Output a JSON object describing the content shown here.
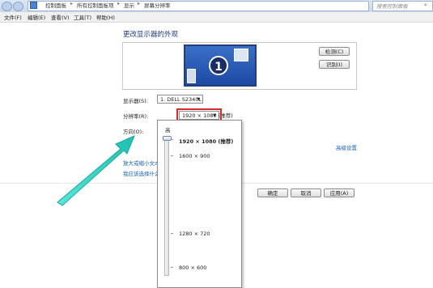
{
  "address_bar": {
    "crumbs": [
      "控制面板",
      "所有控制面板项",
      "显示",
      "屏幕分辨率"
    ],
    "search_placeholder": "搜索控制面板"
  },
  "menu": [
    "文件(F)",
    "编辑(E)",
    "查看(V)",
    "工具(T)",
    "帮助(H)"
  ],
  "main": {
    "title": "更改显示器的外观",
    "monitor_number": "1",
    "detect_label": "检测(C)",
    "identify_label": "识别(I)",
    "display_label": "显示器(S):",
    "display_value": "1. DELL S2340L",
    "resolution_label": "分辨率(R):",
    "resolution_value": "1920 × 1080 (推荐)",
    "orientation_label": "方向(O):",
    "advanced_link": "高级设置",
    "link_text_size": "放大或缩小文本",
    "link_which": "我应该选择什么"
  },
  "slider": {
    "top_label": "高",
    "options": [
      "1920 × 1080 (推荐)",
      "1600 × 900",
      "1280 × 720",
      "800 × 600"
    ],
    "selected": "1920 × 1080 (推荐)"
  },
  "buttons": {
    "ok": "确定",
    "cancel": "取消",
    "apply": "应用(A)"
  },
  "colors": {
    "title": "#1e3a8a",
    "link": "#1560b7",
    "highlight_border": "#d62a2a",
    "arrow": "#2fd3c2"
  }
}
